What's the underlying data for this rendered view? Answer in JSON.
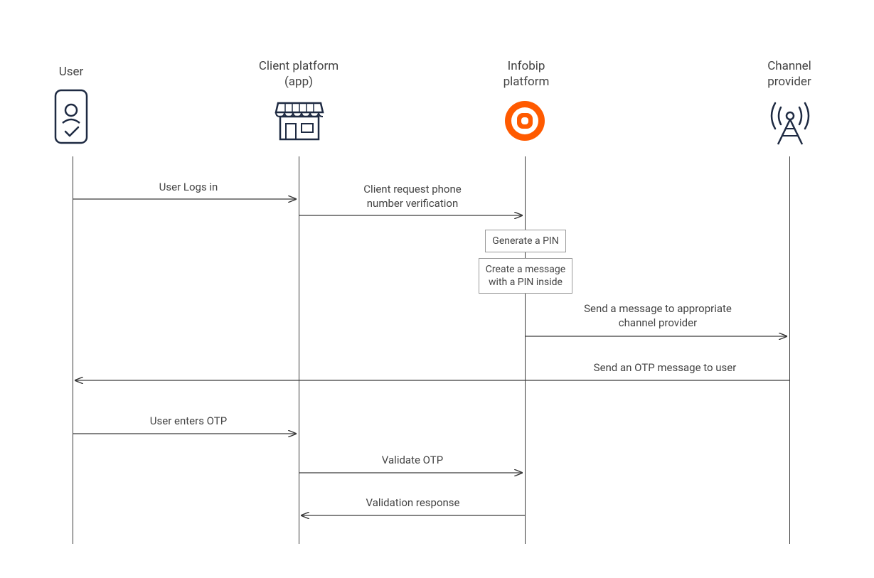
{
  "participants": {
    "user": {
      "label": "User"
    },
    "client": {
      "label": "Client platform\n(app)"
    },
    "infobip": {
      "label": "Infobip\nplatform"
    },
    "channel": {
      "label": "Channel\nprovider"
    }
  },
  "messages": {
    "m1": "User Logs in",
    "m2": "Client request phone\nnumber verification",
    "m3": "Generate a PIN",
    "m4": "Create a message\nwith a PIN inside",
    "m5": "Send a message to appropriate\nchannel provider",
    "m6": "Send an OTP message to user",
    "m7": "User enters OTP",
    "m8": "Validate OTP",
    "m9": "Validation response"
  },
  "colors": {
    "lineNavy": "#1e2a42",
    "accentOrange": "#ff5a00",
    "text": "#444444"
  }
}
